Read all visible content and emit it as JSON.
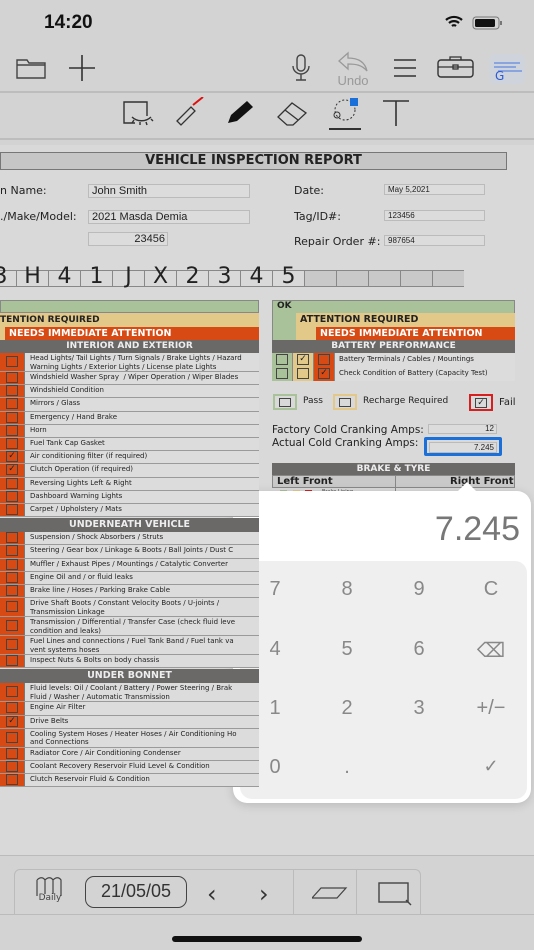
{
  "status": {
    "time": "14:20"
  },
  "toolbar": {
    "undo_label": "Undo",
    "icons": [
      "folder-icon",
      "plus-icon",
      "microphone-icon",
      "undo-icon",
      "menu-icon",
      "toolbox-icon",
      "translate-icon"
    ]
  },
  "tools": [
    "lasso-hide-icon",
    "laser-pointer-icon",
    "pen-icon",
    "eraser-icon",
    "lasso-select-icon",
    "text-icon"
  ],
  "colors": {
    "ok": "#a9c29a",
    "attention": "#e2c98a",
    "immediate": "#d84a14",
    "section": "#6b6868",
    "fail": "#d81e1e",
    "active_field": "#1a6fd8"
  },
  "report": {
    "title": "VEHICLE INSPECTION REPORT",
    "name_label": "n Name:",
    "name": "John Smith",
    "model_label": "./Make/Model:",
    "model": "2021 Masda Demia",
    "mileage": "23456",
    "date_label": "Date:",
    "date": "May 5,2021",
    "tag_label": "Tag/ID#:",
    "tag": "123456",
    "repair_label": "Repair Order #:",
    "repair": "987654",
    "vin": [
      "3",
      "H",
      "4",
      "1",
      "J",
      "X",
      "2",
      "3",
      "4",
      "5",
      "",
      "",
      "",
      "",
      ""
    ]
  },
  "left": {
    "legend_attention": "TENTION REQUIRED",
    "legend_immediate": "NEEDS IMMEDIATE ATTENTION",
    "sections": [
      {
        "title": "INTERIOR AND EXTERIOR",
        "items": [
          {
            "text": "Head Lights/ Tail Lights / Turn Signals / Brake Lights / Hazard\nWarning Lights / Exterior Lights / License plate Lights",
            "checked": false
          },
          {
            "text": "Windshield Washer Spray  / Wiper Operation / Wiper Blades",
            "checked": false
          },
          {
            "text": "Windshield Condition",
            "checked": false
          },
          {
            "text": "Mirrors / Glass",
            "checked": false
          },
          {
            "text": "Emergency / Hand Brake",
            "checked": false
          },
          {
            "text": "Horn",
            "checked": false
          },
          {
            "text": "Fuel Tank Cap Gasket",
            "checked": false
          },
          {
            "text": "Air conditioning filter (if required)",
            "checked": true
          },
          {
            "text": "Clutch Operation (if required)",
            "checked": true
          },
          {
            "text": "Reversing Lights Left & Right",
            "checked": false
          },
          {
            "text": "Dashboard Warning Lights",
            "checked": false
          },
          {
            "text": "Carpet / Upholstery / Mats",
            "checked": false
          }
        ]
      },
      {
        "title": "UNDERNEATH VEHICLE",
        "items": [
          {
            "text": "Suspension / Shock Absorbers / Struts",
            "checked": false
          },
          {
            "text": "Steering / Gear box / Linkage & Boots / Ball Joints / Dust C",
            "checked": false
          },
          {
            "text": "Muffler / Exhaust Pipes / Mountings / Catalytic Converter",
            "checked": false
          },
          {
            "text": "Engine Oil and / or fluid leaks",
            "checked": false
          },
          {
            "text": "Brake line / Hoses / Parking Brake Cable",
            "checked": false
          },
          {
            "text": "Drive Shaft Boots / Constant Velocity Boots / U-joints /\nTransmission Linkage",
            "checked": false
          },
          {
            "text": "Transmission / Differential / Transfer Case (check fluid leve\ncondition and leaks)",
            "checked": false
          },
          {
            "text": "Fuel Lines and connections / Fuel Tank Band / Fuel tank va\nvent systems hoses",
            "checked": false
          },
          {
            "text": "Inspect Nuts & Bolts on body chassis",
            "checked": false
          }
        ]
      },
      {
        "title": "UNDER BONNET",
        "items": [
          {
            "text": "Fluid levels: Oil / Coolant / Battery / Power Steering / Brak\nFluid / Washer / Automatic Transmission",
            "checked": false
          },
          {
            "text": "Engine Air Filter",
            "checked": false
          },
          {
            "text": "Drive Belts",
            "checked": true
          },
          {
            "text": "Cooling System Hoses / Heater Hoses / Air Conditioning Ho\nand Connections",
            "checked": false
          },
          {
            "text": "Radiator Core / Air Conditioning Condenser",
            "checked": false
          },
          {
            "text": "Coolant Recovery Reservoir Fluid Level & Condition",
            "checked": false
          },
          {
            "text": "Clutch Reservoir Fluid & Condition",
            "checked": false
          }
        ]
      }
    ]
  },
  "right": {
    "legend_ok": "OK",
    "legend_attention": "ATTENTION REQUIRED",
    "legend_immediate": "NEEDS IMMEDIATE ATTENTION",
    "battery_title": "BATTERY PERFORMANCE",
    "battery_items": [
      {
        "text": "Battery Terminals / Cables / Mountings",
        "checked": "attention"
      },
      {
        "text": "Check Condition of Battery (Capacity Test)",
        "checked": "immediate"
      }
    ],
    "pass_label": "Pass",
    "recharge_label": "Recharge Required",
    "fail_label": "Fail",
    "result": "Fail",
    "factory_label": "Factory Cold Cranking Amps:",
    "factory_value": "12",
    "actual_label": "Actual Cold Cranking Amps:",
    "actual_value": "7.245",
    "brake_title": "BRAKE & TYRE",
    "left_front": "Left Front",
    "right_front": "Right Front",
    "brake_lining": "Brake Lining",
    "mm": "mm"
  },
  "calculator": {
    "display": "7.245",
    "keys": [
      [
        "7",
        "8",
        "9",
        "C"
      ],
      [
        "4",
        "5",
        "6",
        "⌫"
      ],
      [
        "1",
        "2",
        "3",
        "+/−"
      ],
      [
        "0",
        ".",
        "",
        "✓"
      ]
    ]
  },
  "bottom": {
    "daily_label": "Daily",
    "date": "21/05/05"
  }
}
